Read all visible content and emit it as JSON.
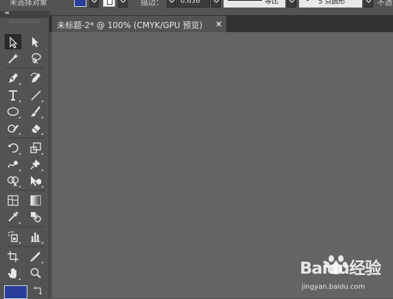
{
  "control_bar": {
    "selection_label": "未选择对象",
    "fill_color": "#2a3f9a",
    "stroke_color": "#ffffff",
    "stroke_label": "描边：",
    "stroke_weight": "0.636",
    "profile_label": "等比",
    "brush_size": "5",
    "brush_label": "点圆形",
    "trailing_label": "不透"
  },
  "document_tab": {
    "title": "未标题-2* @ 100% (CMYK/GPU 预览)",
    "close_glyph": "×"
  },
  "toolbar": {
    "collapse_glyph": "◂◂",
    "fill_color": "#2a3f9a",
    "tools": [
      "selection-tool",
      "direct-selection-tool",
      "magic-wand-tool",
      "lasso-tool",
      "pen-tool",
      "curvature-tool",
      "type-tool",
      "line-segment-tool",
      "ellipse-tool",
      "paintbrush-tool",
      "shaper-tool",
      "eraser-tool",
      "rotate-tool",
      "scale-tool",
      "warp-tool",
      "puppet-warp-tool",
      "shape-builder-tool",
      "perspective-grid-tool",
      "mesh-tool",
      "gradient-tool",
      "eyedropper-tool",
      "blend-tool",
      "symbol-sprayer-tool",
      "column-graph-tool",
      "artboard-tool",
      "slice-tool",
      "hand-tool",
      "zoom-tool"
    ]
  },
  "watermark": {
    "brand": "Baidu经验",
    "url": "jingyan.baidu.com"
  },
  "colors": {
    "canvas": "#646464",
    "panel": "#535353",
    "tabbar": "#323232",
    "accent_blue": "#2a3f9a"
  }
}
